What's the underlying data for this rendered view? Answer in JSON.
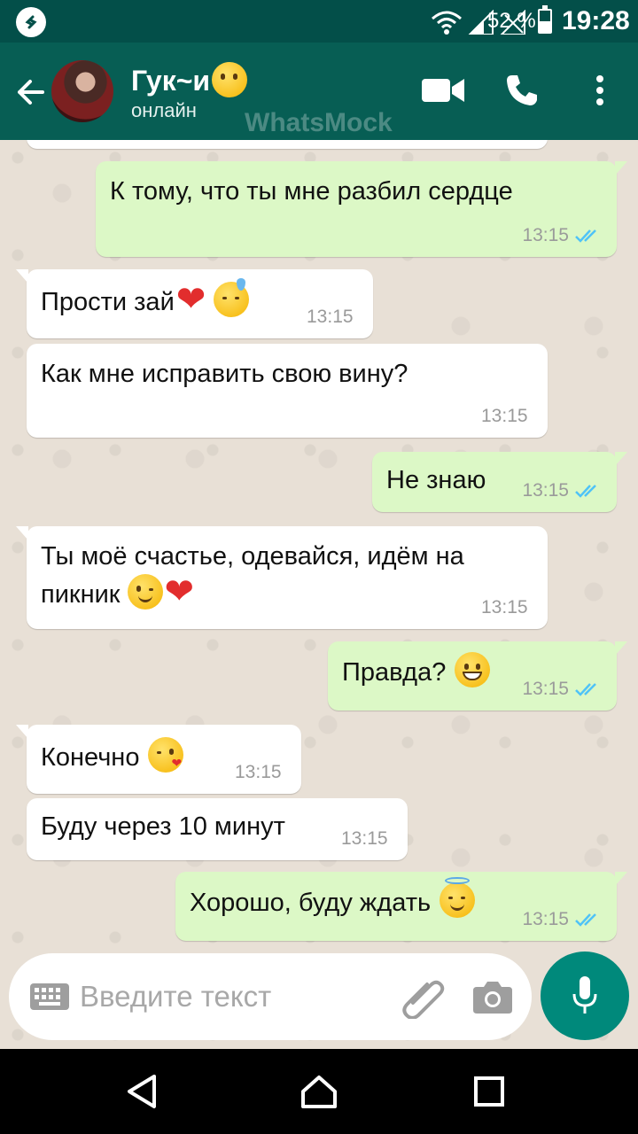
{
  "status_bar": {
    "battery_percent": "52 %",
    "battery_level": 0.52,
    "time": "19:28"
  },
  "header": {
    "contact_name": "Гук~и",
    "contact_status": "онлайн",
    "watermark": "WhatsMock",
    "icons": [
      "back-arrow-icon",
      "video-call-icon",
      "phone-icon",
      "more-vert-icon"
    ]
  },
  "messages": [
    {
      "direction": "out",
      "text": "К тому, что ты мне разбил сердце",
      "emojis": [],
      "time": "13:15",
      "read": true
    },
    {
      "direction": "in",
      "text": "Прости зай",
      "emojis": [
        "red-heart",
        "downcast-sweat-face"
      ],
      "time": "13:15"
    },
    {
      "direction": "in",
      "text": "Как мне исправить свою вину?",
      "emojis": [],
      "time": "13:15"
    },
    {
      "direction": "out",
      "text": "Не знаю",
      "emojis": [],
      "time": "13:15",
      "read": true
    },
    {
      "direction": "in",
      "text": "Ты моё счастье, одевайся, идём на пикник",
      "emojis": [
        "winking-face",
        "red-heart"
      ],
      "time": "13:15"
    },
    {
      "direction": "out",
      "text": "Правда?",
      "emojis": [
        "grinning-face"
      ],
      "time": "13:15",
      "read": true
    },
    {
      "direction": "in",
      "text": "Конечно",
      "emojis": [
        "kiss-face"
      ],
      "time": "13:15"
    },
    {
      "direction": "in",
      "text": "Буду через 10 минут",
      "emojis": [],
      "time": "13:15"
    },
    {
      "direction": "out",
      "text": "Хорошо, буду ждать",
      "emojis": [
        "halo-face"
      ],
      "time": "13:15",
      "read": true
    }
  ],
  "input": {
    "placeholder": "Введите текст"
  },
  "colors": {
    "header": "#075e54",
    "status_bar": "#034f49",
    "outgoing_bubble": "#dcf8c6",
    "incoming_bubble": "#ffffff",
    "mic_button": "#00897b",
    "read_ticks": "#4fc3f7"
  }
}
